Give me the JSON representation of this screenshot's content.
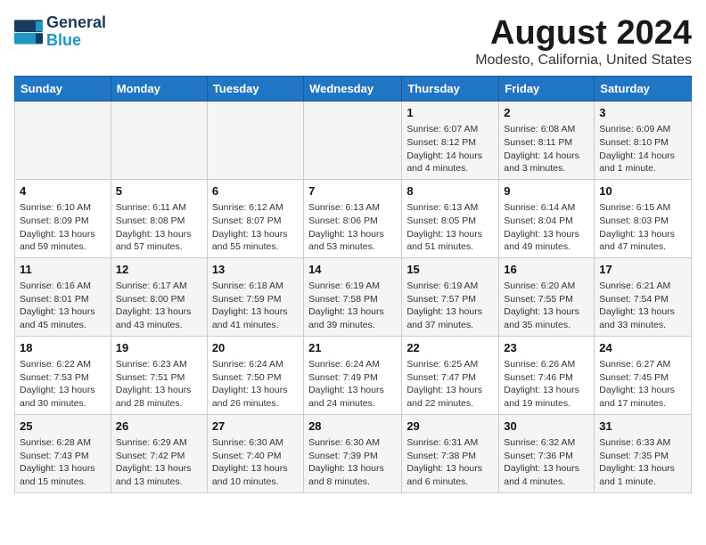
{
  "header": {
    "logo_line1": "General",
    "logo_line2": "Blue",
    "title": "August 2024",
    "subtitle": "Modesto, California, United States"
  },
  "days_of_week": [
    "Sunday",
    "Monday",
    "Tuesday",
    "Wednesday",
    "Thursday",
    "Friday",
    "Saturday"
  ],
  "weeks": [
    [
      {
        "day": "",
        "info": ""
      },
      {
        "day": "",
        "info": ""
      },
      {
        "day": "",
        "info": ""
      },
      {
        "day": "",
        "info": ""
      },
      {
        "day": "1",
        "info": "Sunrise: 6:07 AM\nSunset: 8:12 PM\nDaylight: 14 hours\nand 4 minutes."
      },
      {
        "day": "2",
        "info": "Sunrise: 6:08 AM\nSunset: 8:11 PM\nDaylight: 14 hours\nand 3 minutes."
      },
      {
        "day": "3",
        "info": "Sunrise: 6:09 AM\nSunset: 8:10 PM\nDaylight: 14 hours\nand 1 minute."
      }
    ],
    [
      {
        "day": "4",
        "info": "Sunrise: 6:10 AM\nSunset: 8:09 PM\nDaylight: 13 hours\nand 59 minutes."
      },
      {
        "day": "5",
        "info": "Sunrise: 6:11 AM\nSunset: 8:08 PM\nDaylight: 13 hours\nand 57 minutes."
      },
      {
        "day": "6",
        "info": "Sunrise: 6:12 AM\nSunset: 8:07 PM\nDaylight: 13 hours\nand 55 minutes."
      },
      {
        "day": "7",
        "info": "Sunrise: 6:13 AM\nSunset: 8:06 PM\nDaylight: 13 hours\nand 53 minutes."
      },
      {
        "day": "8",
        "info": "Sunrise: 6:13 AM\nSunset: 8:05 PM\nDaylight: 13 hours\nand 51 minutes."
      },
      {
        "day": "9",
        "info": "Sunrise: 6:14 AM\nSunset: 8:04 PM\nDaylight: 13 hours\nand 49 minutes."
      },
      {
        "day": "10",
        "info": "Sunrise: 6:15 AM\nSunset: 8:03 PM\nDaylight: 13 hours\nand 47 minutes."
      }
    ],
    [
      {
        "day": "11",
        "info": "Sunrise: 6:16 AM\nSunset: 8:01 PM\nDaylight: 13 hours\nand 45 minutes."
      },
      {
        "day": "12",
        "info": "Sunrise: 6:17 AM\nSunset: 8:00 PM\nDaylight: 13 hours\nand 43 minutes."
      },
      {
        "day": "13",
        "info": "Sunrise: 6:18 AM\nSunset: 7:59 PM\nDaylight: 13 hours\nand 41 minutes."
      },
      {
        "day": "14",
        "info": "Sunrise: 6:19 AM\nSunset: 7:58 PM\nDaylight: 13 hours\nand 39 minutes."
      },
      {
        "day": "15",
        "info": "Sunrise: 6:19 AM\nSunset: 7:57 PM\nDaylight: 13 hours\nand 37 minutes."
      },
      {
        "day": "16",
        "info": "Sunrise: 6:20 AM\nSunset: 7:55 PM\nDaylight: 13 hours\nand 35 minutes."
      },
      {
        "day": "17",
        "info": "Sunrise: 6:21 AM\nSunset: 7:54 PM\nDaylight: 13 hours\nand 33 minutes."
      }
    ],
    [
      {
        "day": "18",
        "info": "Sunrise: 6:22 AM\nSunset: 7:53 PM\nDaylight: 13 hours\nand 30 minutes."
      },
      {
        "day": "19",
        "info": "Sunrise: 6:23 AM\nSunset: 7:51 PM\nDaylight: 13 hours\nand 28 minutes."
      },
      {
        "day": "20",
        "info": "Sunrise: 6:24 AM\nSunset: 7:50 PM\nDaylight: 13 hours\nand 26 minutes."
      },
      {
        "day": "21",
        "info": "Sunrise: 6:24 AM\nSunset: 7:49 PM\nDaylight: 13 hours\nand 24 minutes."
      },
      {
        "day": "22",
        "info": "Sunrise: 6:25 AM\nSunset: 7:47 PM\nDaylight: 13 hours\nand 22 minutes."
      },
      {
        "day": "23",
        "info": "Sunrise: 6:26 AM\nSunset: 7:46 PM\nDaylight: 13 hours\nand 19 minutes."
      },
      {
        "day": "24",
        "info": "Sunrise: 6:27 AM\nSunset: 7:45 PM\nDaylight: 13 hours\nand 17 minutes."
      }
    ],
    [
      {
        "day": "25",
        "info": "Sunrise: 6:28 AM\nSunset: 7:43 PM\nDaylight: 13 hours\nand 15 minutes."
      },
      {
        "day": "26",
        "info": "Sunrise: 6:29 AM\nSunset: 7:42 PM\nDaylight: 13 hours\nand 13 minutes."
      },
      {
        "day": "27",
        "info": "Sunrise: 6:30 AM\nSunset: 7:40 PM\nDaylight: 13 hours\nand 10 minutes."
      },
      {
        "day": "28",
        "info": "Sunrise: 6:30 AM\nSunset: 7:39 PM\nDaylight: 13 hours\nand 8 minutes."
      },
      {
        "day": "29",
        "info": "Sunrise: 6:31 AM\nSunset: 7:38 PM\nDaylight: 13 hours\nand 6 minutes."
      },
      {
        "day": "30",
        "info": "Sunrise: 6:32 AM\nSunset: 7:36 PM\nDaylight: 13 hours\nand 4 minutes."
      },
      {
        "day": "31",
        "info": "Sunrise: 6:33 AM\nSunset: 7:35 PM\nDaylight: 13 hours\nand 1 minute."
      }
    ]
  ]
}
